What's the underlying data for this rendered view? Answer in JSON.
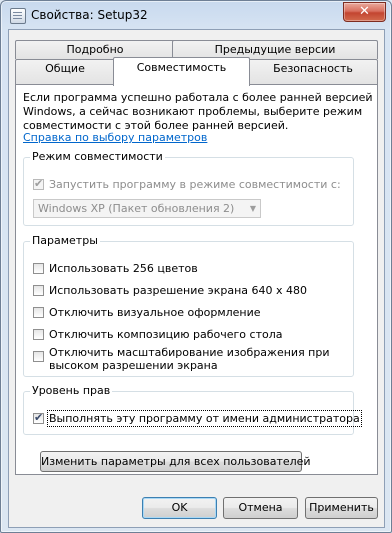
{
  "window": {
    "title": "Свойства: Setup32",
    "close_label": "✕"
  },
  "tabs": {
    "row1": [
      "Подробно",
      "Предыдущие версии"
    ],
    "row2": [
      "Общие",
      "Совместимость",
      "Безопасность"
    ],
    "active": "Совместимость"
  },
  "compat": {
    "intro": "Если программа успешно работала с более ранней версией Windows, а сейчас возникают проблемы, выберите режим совместимости с этой более ранней версией.",
    "help_link": "Справка по выбору параметров",
    "mode_group": "Режим совместимости",
    "mode_checkbox": "Запустить программу в режиме совместимости с:",
    "mode_checked": true,
    "mode_select": "Windows XP (Пакет обновления 2)"
  },
  "params": {
    "group": "Параметры",
    "items": [
      "Использовать 256 цветов",
      "Использовать разрешение экрана 640 x 480",
      "Отключить визуальное оформление",
      "Отключить композицию рабочего стола",
      "Отключить масштабирование изображения при высоком разрешении экрана"
    ],
    "item5_line1": "Отключить масштабирование изображения при",
    "item5_line2": "высоком разрешении экрана"
  },
  "privilege": {
    "group": "Уровень прав",
    "checkbox": "Выполнять эту программу от имени администратора",
    "checked": true
  },
  "buttons": {
    "change_all": "Изменить параметры для всех пользователей",
    "ok": "OK",
    "cancel": "Отмена",
    "apply": "Применить"
  }
}
